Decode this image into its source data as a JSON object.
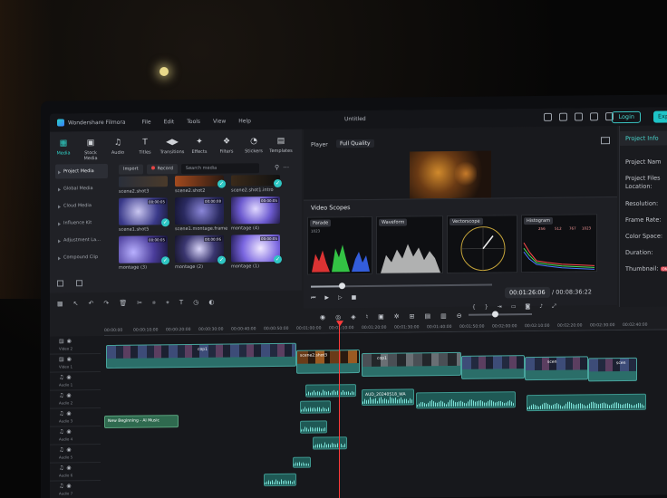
{
  "app": {
    "name": "Wondershare Filmora",
    "menu": [
      "File",
      "Edit",
      "Tools",
      "View",
      "Help"
    ],
    "window_title": "Untitled",
    "login_label": "Login",
    "export_label": "Expo"
  },
  "toolbar": {
    "items": [
      "Media",
      "Stock Media",
      "Audio",
      "Titles",
      "Transitions",
      "Effects",
      "Filters",
      "Stickers",
      "Templates"
    ]
  },
  "sidebar": {
    "items": [
      "Project Media",
      "Global Media",
      "Cloud Media",
      "Influence Kit",
      "Adjustment La...",
      "Compound Clip"
    ]
  },
  "media": {
    "import_label": "Import",
    "record_label": "Record",
    "search_placeholder": "Search media",
    "thumbs": [
      {
        "label": "scene2.shot3",
        "duration": ""
      },
      {
        "label": "scene2.shot2",
        "duration": ""
      },
      {
        "label": "scene2.shot1.intro",
        "duration": ""
      },
      {
        "label": "scene1.shot5",
        "duration": "00:00:05"
      },
      {
        "label": "scene1.montage.frame",
        "duration": "00:00:08"
      },
      {
        "label": "montage (4)",
        "duration": "00:00:05"
      },
      {
        "label": "montage (3)",
        "duration": "00:00:05"
      },
      {
        "label": "montage (2)",
        "duration": "00:00:06"
      },
      {
        "label": "montage (1)",
        "duration": "00:00:05"
      }
    ]
  },
  "player": {
    "label": "Player",
    "quality": "Full Quality",
    "current_time": "00:01:26:06",
    "total_time": "/ 00:08:36:22",
    "progress": 0.17
  },
  "scopes": {
    "title": "Video Scopes",
    "tabs": [
      "Parade",
      "Waveform",
      "Vectorscope",
      "Histogram"
    ],
    "parade_max": "1023",
    "histogram_values": [
      "256",
      "512",
      "767",
      "1023"
    ]
  },
  "project": {
    "title": "Project Info",
    "fields": [
      "Project Nam",
      "Project Files",
      "Location:",
      "Resolution:",
      "Frame Rate:",
      "Color Space:",
      "Duration:",
      "Thumbnail:"
    ],
    "thumbnail_badge": "ON"
  },
  "timeline": {
    "ruler": [
      "00:00:00",
      "00:00:10:00",
      "00:00:20:00",
      "00:00:30:00",
      "00:00:40:00",
      "00:00:50:00",
      "00:01:00:00",
      "00:01:10:00",
      "00:01:20:00",
      "00:01:30:00",
      "00:01:40:00",
      "00:01:50:00",
      "00:02:00:00",
      "00:02:10:00",
      "00:02:20:00",
      "00:02:30:00",
      "00:02:40:00"
    ],
    "tracks": [
      "Video 2",
      "Video 1",
      "Audio 1",
      "Audio 2",
      "Audio 3",
      "Audio 4",
      "Audio 5",
      "Audio 6",
      "Audio 7"
    ],
    "clips": {
      "clip1": "cop1",
      "clip2": "scene2.shot3",
      "clip3": "cop1",
      "clip4": "scen",
      "clip5": "scen",
      "audio_clip": "AUD_20240518_WA",
      "music_clip": "New Beginning - AI Music"
    }
  },
  "colors": {
    "accent": "#2fd2c7",
    "playhead": "#ff3b3b",
    "clip": "#2b6e69"
  }
}
